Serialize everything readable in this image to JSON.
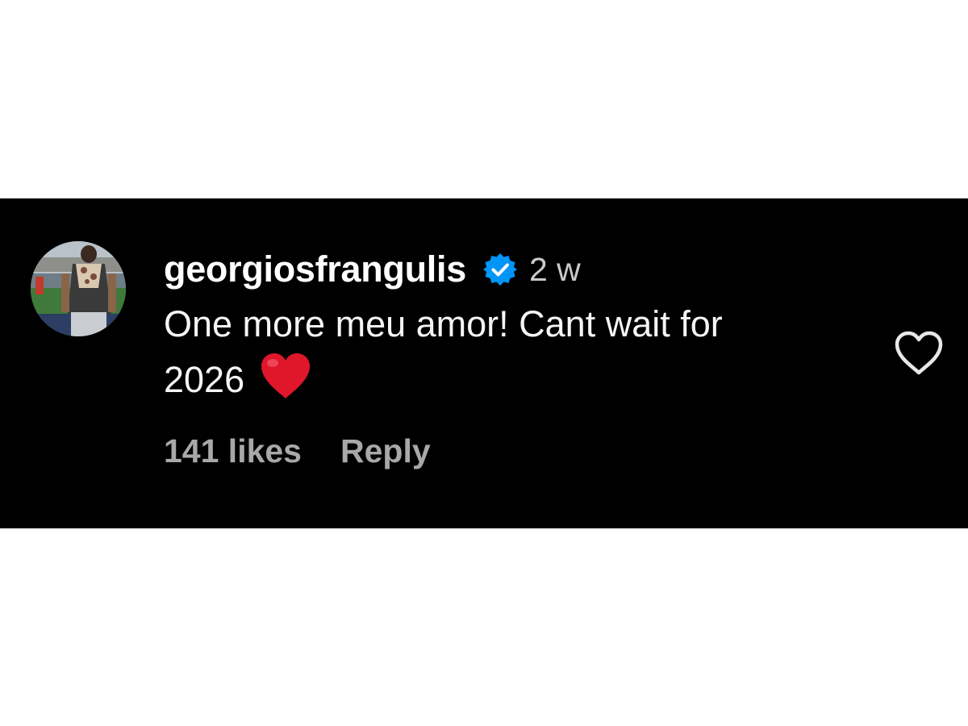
{
  "comment": {
    "username": "georgiosfrangulis",
    "verified": true,
    "time": "2 w",
    "text_line1": "One more meu amor! Cant wait for",
    "text_line2": "2026",
    "emoji": "red-heart-emoji",
    "likes": "141 likes",
    "reply_label": "Reply"
  },
  "icons": {
    "verified": "verified-badge-icon",
    "like": "heart-outline-icon"
  },
  "colors": {
    "panel_bg": "#000000",
    "verified_blue": "#0095f6",
    "heart_red": "#e0162b",
    "muted_text": "#a8a8a8"
  }
}
